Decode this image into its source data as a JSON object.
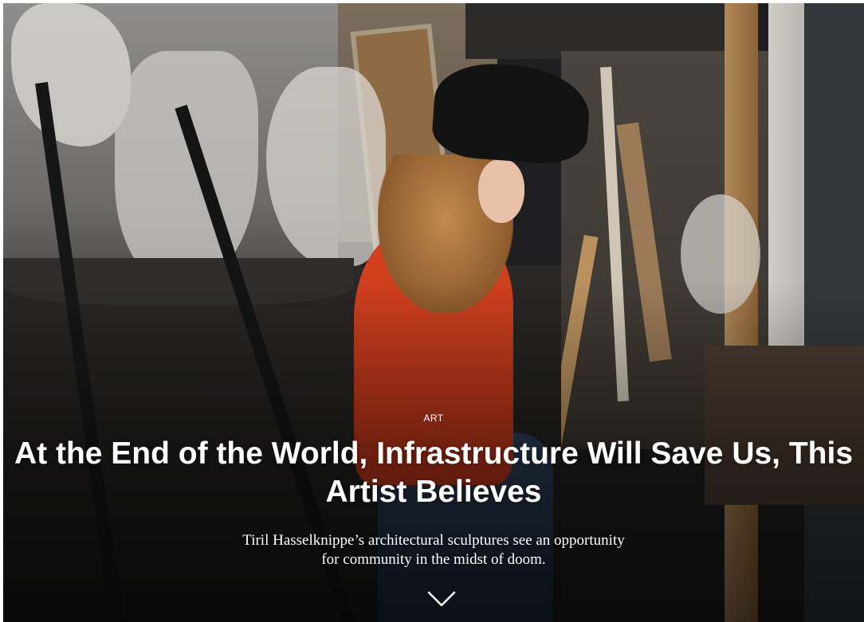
{
  "hero": {
    "category_label": "ART",
    "headline": "At the End of the World, Infrastructure Will Save Us, This Artist Believes",
    "dek": "Tiril Hasselknippe’s architectural sculptures see an opportunity for community in the midst of doom.",
    "scroll_icon": "chevron-down-icon"
  },
  "colors": {
    "text": "#ffffff",
    "sweater": "#c73a1c",
    "background": "#1f1f21"
  }
}
